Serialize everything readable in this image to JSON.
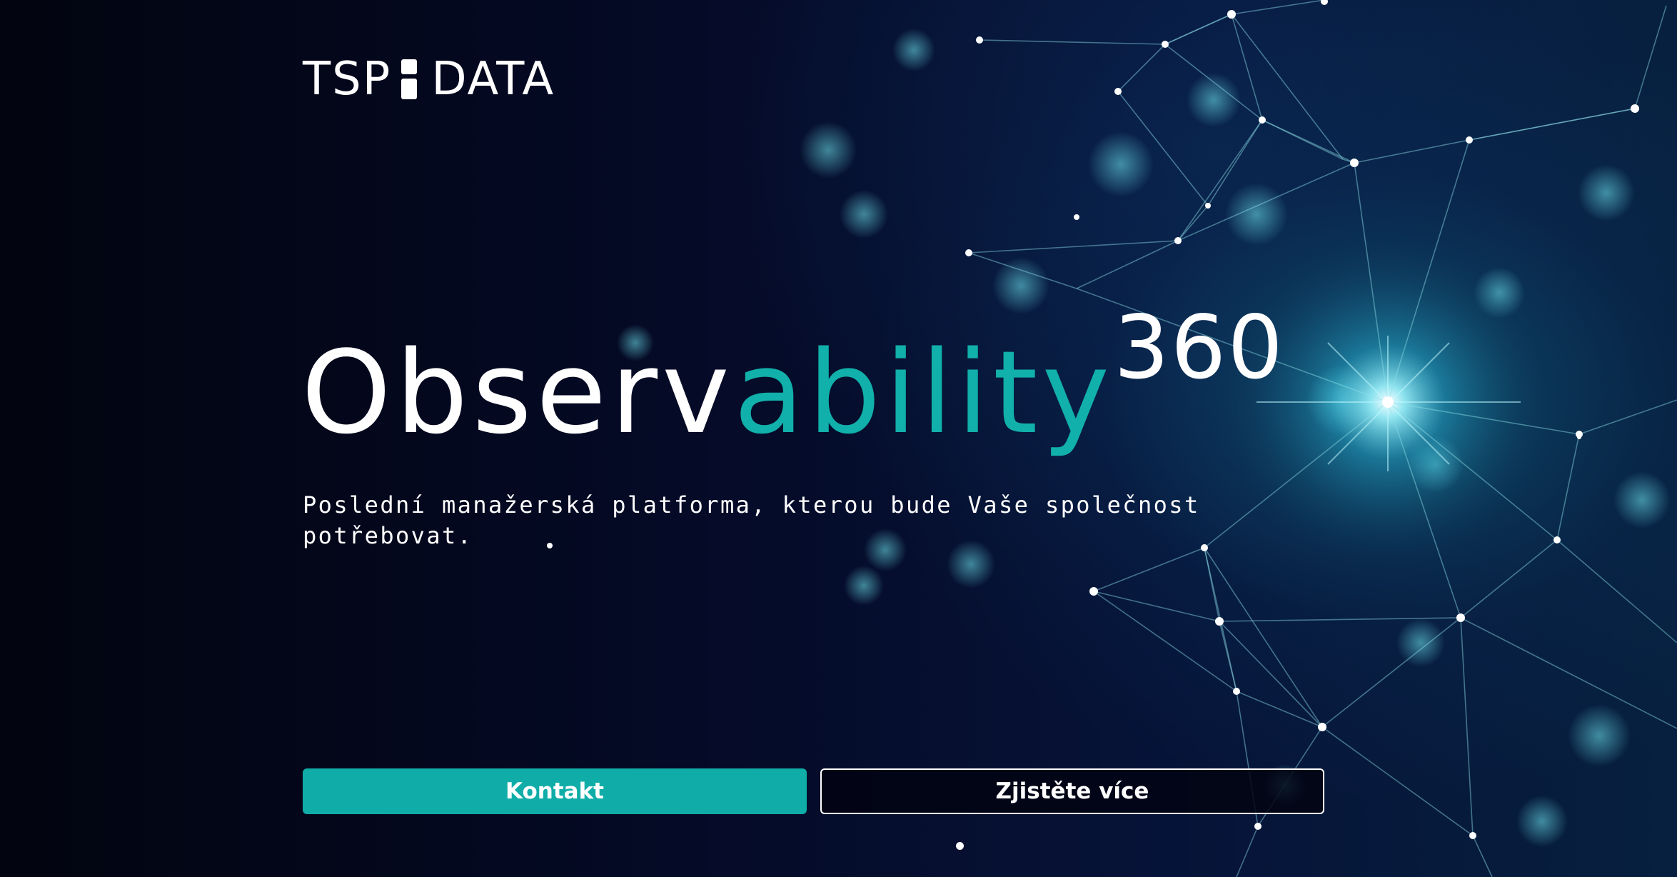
{
  "logo": {
    "left_text": "TSP",
    "right_text": "DATA"
  },
  "hero": {
    "title_part1": "Observ",
    "title_part2": "ability",
    "title_superscript": "360",
    "subtitle_line1": "Poslední manažerská platforma, kterou bude Vaše společnost",
    "subtitle_line2": "potřebovat."
  },
  "buttons": {
    "primary_label": "Kontakt",
    "secondary_label": "Zjistěte více"
  },
  "colors": {
    "accent": "#10ada8",
    "background": "#03061a",
    "text": "#ffffff"
  },
  "icons": {
    "background": "network-graph-icon",
    "scroll_indicator": "scroll-dot-icon"
  }
}
